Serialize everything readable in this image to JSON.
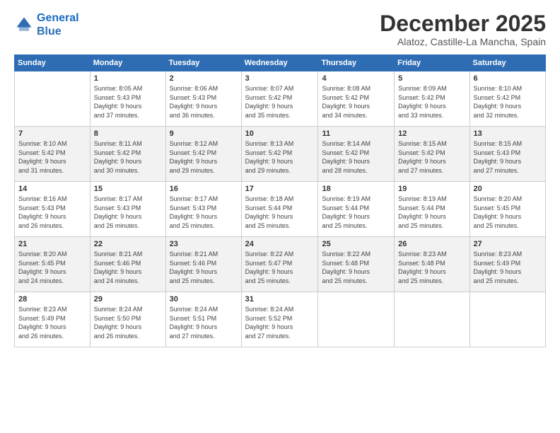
{
  "logo": {
    "line1": "General",
    "line2": "Blue"
  },
  "title": "December 2025",
  "location": "Alatoz, Castille-La Mancha, Spain",
  "headers": [
    "Sunday",
    "Monday",
    "Tuesday",
    "Wednesday",
    "Thursday",
    "Friday",
    "Saturday"
  ],
  "weeks": [
    [
      {
        "day": "",
        "info": ""
      },
      {
        "day": "1",
        "info": "Sunrise: 8:05 AM\nSunset: 5:43 PM\nDaylight: 9 hours\nand 37 minutes."
      },
      {
        "day": "2",
        "info": "Sunrise: 8:06 AM\nSunset: 5:43 PM\nDaylight: 9 hours\nand 36 minutes."
      },
      {
        "day": "3",
        "info": "Sunrise: 8:07 AM\nSunset: 5:42 PM\nDaylight: 9 hours\nand 35 minutes."
      },
      {
        "day": "4",
        "info": "Sunrise: 8:08 AM\nSunset: 5:42 PM\nDaylight: 9 hours\nand 34 minutes."
      },
      {
        "day": "5",
        "info": "Sunrise: 8:09 AM\nSunset: 5:42 PM\nDaylight: 9 hours\nand 33 minutes."
      },
      {
        "day": "6",
        "info": "Sunrise: 8:10 AM\nSunset: 5:42 PM\nDaylight: 9 hours\nand 32 minutes."
      }
    ],
    [
      {
        "day": "7",
        "info": "Sunrise: 8:10 AM\nSunset: 5:42 PM\nDaylight: 9 hours\nand 31 minutes."
      },
      {
        "day": "8",
        "info": "Sunrise: 8:11 AM\nSunset: 5:42 PM\nDaylight: 9 hours\nand 30 minutes."
      },
      {
        "day": "9",
        "info": "Sunrise: 8:12 AM\nSunset: 5:42 PM\nDaylight: 9 hours\nand 29 minutes."
      },
      {
        "day": "10",
        "info": "Sunrise: 8:13 AM\nSunset: 5:42 PM\nDaylight: 9 hours\nand 29 minutes."
      },
      {
        "day": "11",
        "info": "Sunrise: 8:14 AM\nSunset: 5:42 PM\nDaylight: 9 hours\nand 28 minutes."
      },
      {
        "day": "12",
        "info": "Sunrise: 8:15 AM\nSunset: 5:42 PM\nDaylight: 9 hours\nand 27 minutes."
      },
      {
        "day": "13",
        "info": "Sunrise: 8:15 AM\nSunset: 5:43 PM\nDaylight: 9 hours\nand 27 minutes."
      }
    ],
    [
      {
        "day": "14",
        "info": "Sunrise: 8:16 AM\nSunset: 5:43 PM\nDaylight: 9 hours\nand 26 minutes."
      },
      {
        "day": "15",
        "info": "Sunrise: 8:17 AM\nSunset: 5:43 PM\nDaylight: 9 hours\nand 26 minutes."
      },
      {
        "day": "16",
        "info": "Sunrise: 8:17 AM\nSunset: 5:43 PM\nDaylight: 9 hours\nand 25 minutes."
      },
      {
        "day": "17",
        "info": "Sunrise: 8:18 AM\nSunset: 5:44 PM\nDaylight: 9 hours\nand 25 minutes."
      },
      {
        "day": "18",
        "info": "Sunrise: 8:19 AM\nSunset: 5:44 PM\nDaylight: 9 hours\nand 25 minutes."
      },
      {
        "day": "19",
        "info": "Sunrise: 8:19 AM\nSunset: 5:44 PM\nDaylight: 9 hours\nand 25 minutes."
      },
      {
        "day": "20",
        "info": "Sunrise: 8:20 AM\nSunset: 5:45 PM\nDaylight: 9 hours\nand 25 minutes."
      }
    ],
    [
      {
        "day": "21",
        "info": "Sunrise: 8:20 AM\nSunset: 5:45 PM\nDaylight: 9 hours\nand 24 minutes."
      },
      {
        "day": "22",
        "info": "Sunrise: 8:21 AM\nSunset: 5:46 PM\nDaylight: 9 hours\nand 24 minutes."
      },
      {
        "day": "23",
        "info": "Sunrise: 8:21 AM\nSunset: 5:46 PM\nDaylight: 9 hours\nand 25 minutes."
      },
      {
        "day": "24",
        "info": "Sunrise: 8:22 AM\nSunset: 5:47 PM\nDaylight: 9 hours\nand 25 minutes."
      },
      {
        "day": "25",
        "info": "Sunrise: 8:22 AM\nSunset: 5:48 PM\nDaylight: 9 hours\nand 25 minutes."
      },
      {
        "day": "26",
        "info": "Sunrise: 8:23 AM\nSunset: 5:48 PM\nDaylight: 9 hours\nand 25 minutes."
      },
      {
        "day": "27",
        "info": "Sunrise: 8:23 AM\nSunset: 5:49 PM\nDaylight: 9 hours\nand 25 minutes."
      }
    ],
    [
      {
        "day": "28",
        "info": "Sunrise: 8:23 AM\nSunset: 5:49 PM\nDaylight: 9 hours\nand 26 minutes."
      },
      {
        "day": "29",
        "info": "Sunrise: 8:24 AM\nSunset: 5:50 PM\nDaylight: 9 hours\nand 26 minutes."
      },
      {
        "day": "30",
        "info": "Sunrise: 8:24 AM\nSunset: 5:51 PM\nDaylight: 9 hours\nand 27 minutes."
      },
      {
        "day": "31",
        "info": "Sunrise: 8:24 AM\nSunset: 5:52 PM\nDaylight: 9 hours\nand 27 minutes."
      },
      {
        "day": "",
        "info": ""
      },
      {
        "day": "",
        "info": ""
      },
      {
        "day": "",
        "info": ""
      }
    ]
  ]
}
